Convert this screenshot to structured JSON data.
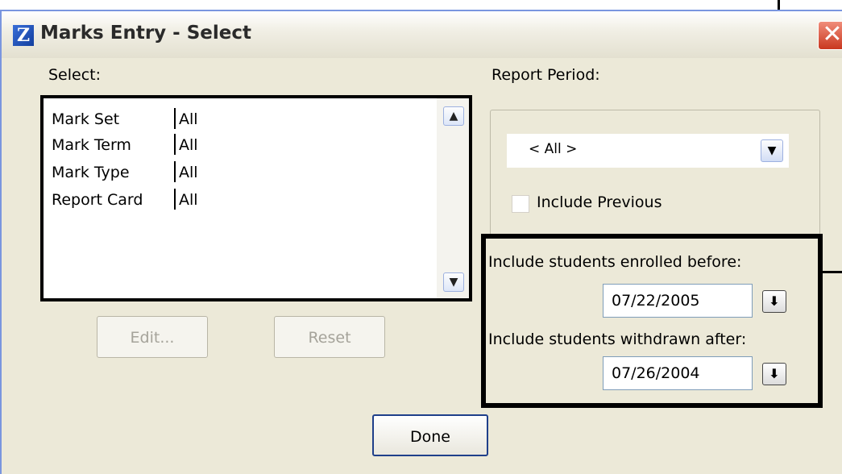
{
  "window": {
    "title": "Marks Entry - Select",
    "close_glyph": "✕",
    "app_icon_glyph": "Z"
  },
  "select_panel": {
    "label": "Select:",
    "rows": [
      {
        "key": "Mark Set",
        "value": "All"
      },
      {
        "key": "Mark Term",
        "value": "All"
      },
      {
        "key": "Mark Type",
        "value": "All"
      },
      {
        "key": "Report Card",
        "value": "All"
      }
    ]
  },
  "buttons": {
    "edit": "Edit...",
    "reset": "Reset",
    "done": "Done"
  },
  "report_period": {
    "label": "Report Period:",
    "selected": "< All >",
    "include_previous": "Include Previous",
    "include_previous_checked": false
  },
  "dates": {
    "enrolled_label": "Include students enrolled before:",
    "enrolled_value": "07/22/2005",
    "withdrawn_label": "Include students withdrawn after:",
    "withdrawn_value": "07/26/2004"
  }
}
